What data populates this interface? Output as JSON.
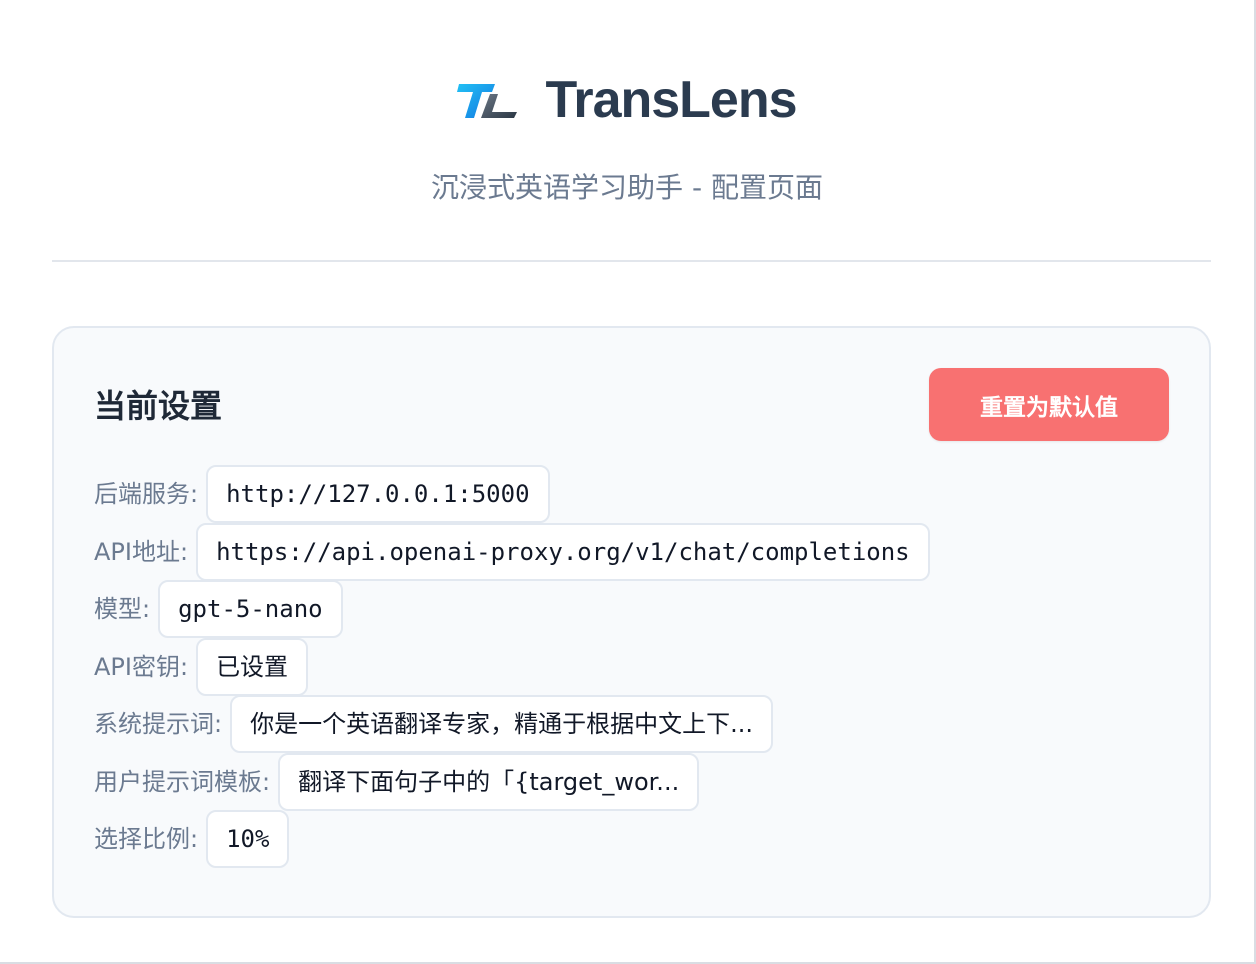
{
  "header": {
    "app_name": "TransLens",
    "logo_text": "TL",
    "subtitle": "沉浸式英语学习助手 - 配置页面"
  },
  "settings_card": {
    "title": "当前设置",
    "reset_button_label": "重置为默认值",
    "rows": [
      {
        "label": "后端服务:",
        "value": "http://127.0.0.1:5000"
      },
      {
        "label": "API地址:",
        "value": "https://api.openai-proxy.org/v1/chat/completions"
      },
      {
        "label": "模型:",
        "value": "gpt-5-nano"
      },
      {
        "label": "API密钥:",
        "value": "已设置"
      },
      {
        "label": "系统提示词:",
        "value": "你是一个英语翻译专家，精通于根据中文上下..."
      },
      {
        "label": "用户提示词模板:",
        "value": "翻译下面句子中的「{target_wor..."
      },
      {
        "label": "选择比例:",
        "value": "10%"
      }
    ]
  },
  "colors": {
    "title": "#2b3b4f",
    "subtitle": "#6b7a90",
    "accent_logo_blue": "#1a9bf0",
    "reset_button": "#f87171",
    "card_background": "#f8fafc"
  }
}
